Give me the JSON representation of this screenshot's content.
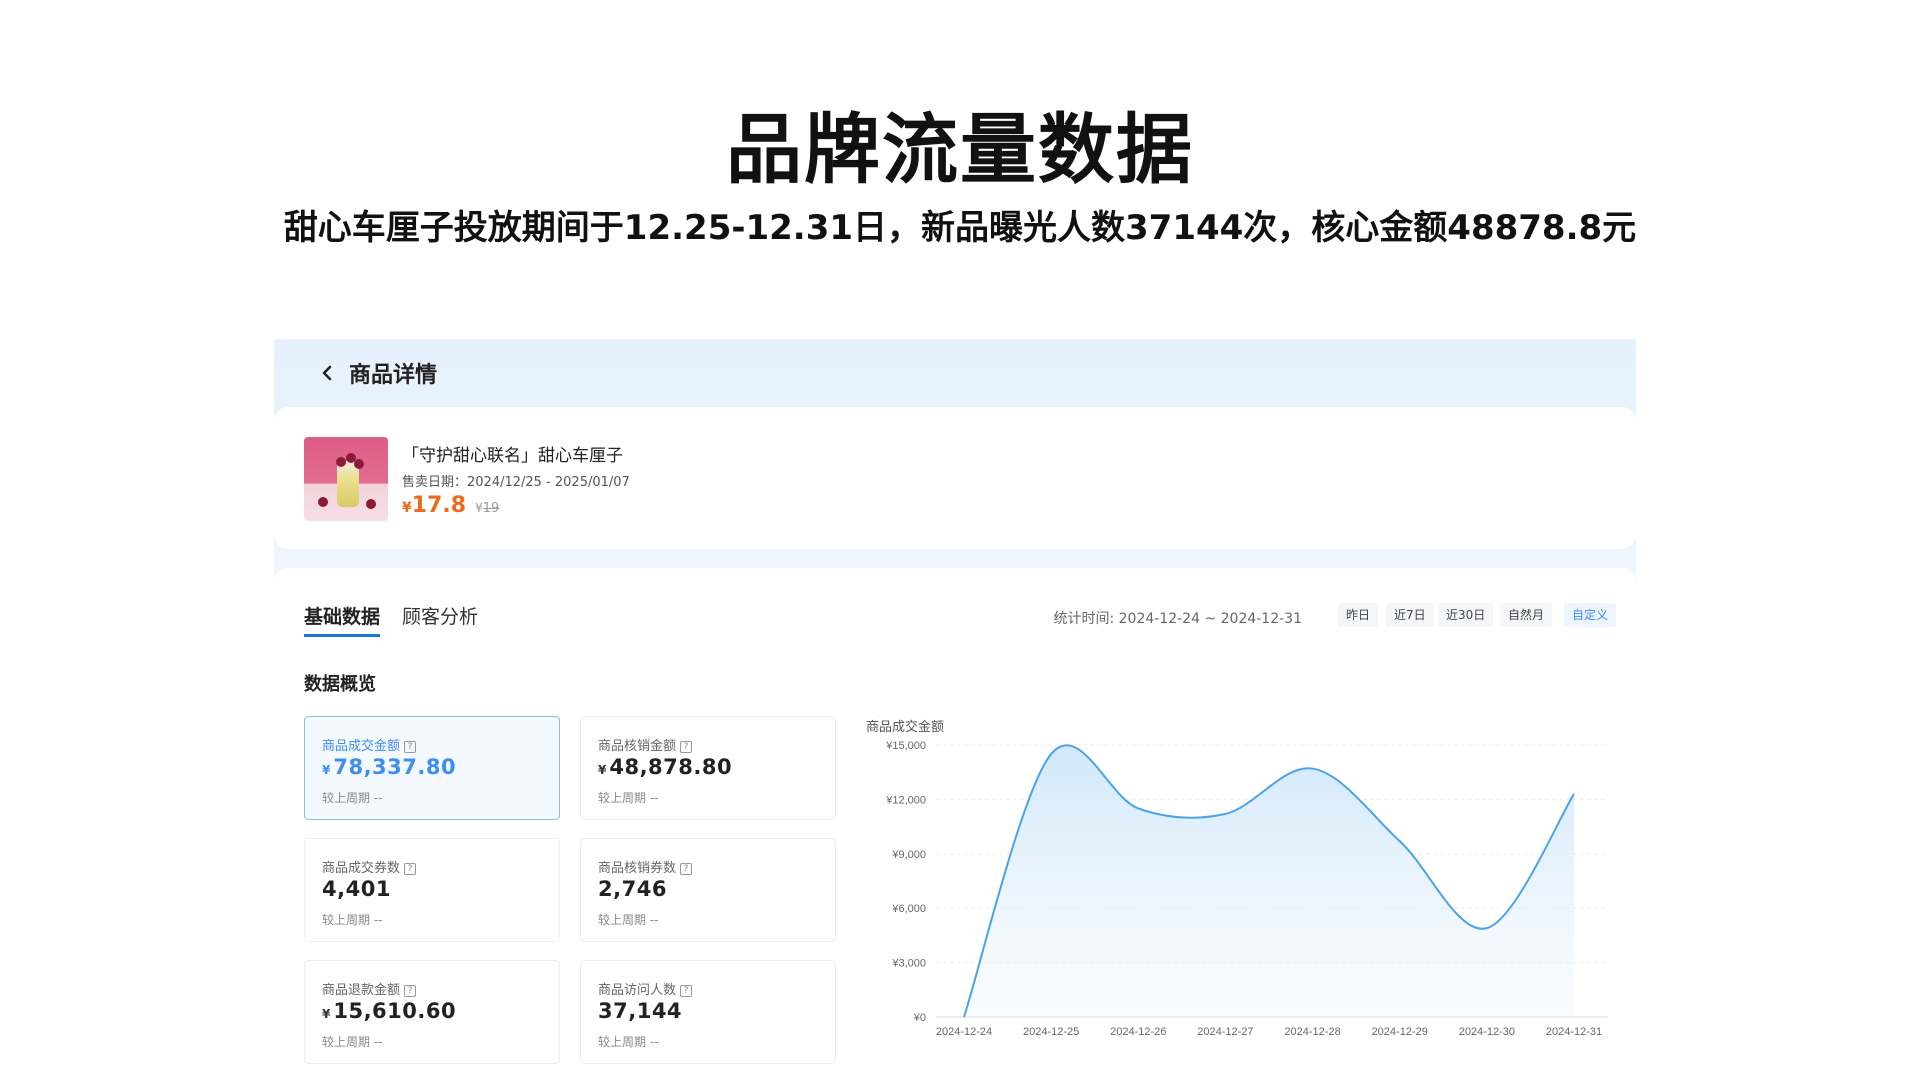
{
  "slide": {
    "title": "品牌流量数据",
    "subtitle": "甜心车厘子投放期间于12.25-12.31日，新品曝光人数37144次，核心金额48878.8元"
  },
  "header": {
    "title": "商品详情"
  },
  "product": {
    "name": "「守护甜心联名」甜心车厘子",
    "sale_date": "售卖日期：2024/12/25 - 2025/01/07",
    "price_symbol": "¥",
    "price": "17.8",
    "original_price_symbol": "¥",
    "original_price": "19"
  },
  "tabs": {
    "basic": "基础数据",
    "customer": "顾客分析"
  },
  "filters": {
    "stat_time": "统计时间: 2024-12-24 ~ 2024-12-31",
    "ranges": [
      "昨日",
      "近7日",
      "近30日",
      "自然月",
      "自定义"
    ],
    "active_range": "自定义"
  },
  "overview": {
    "title": "数据概览",
    "metrics": [
      {
        "label": "商品成交金额",
        "symbol": "¥",
        "value": "78,337.80",
        "compare": "较上周期 --",
        "active": true
      },
      {
        "label": "商品核销金额",
        "symbol": "¥",
        "value": "48,878.80",
        "compare": "较上周期 --",
        "active": false
      },
      {
        "label": "商品成交券数",
        "symbol": "",
        "value": "4,401",
        "compare": "较上周期 --",
        "active": false
      },
      {
        "label": "商品核销券数",
        "symbol": "",
        "value": "2,746",
        "compare": "较上周期 --",
        "active": false
      },
      {
        "label": "商品退款金额",
        "symbol": "¥",
        "value": "15,610.60",
        "compare": "较上周期 --",
        "active": false
      },
      {
        "label": "商品访问人数",
        "symbol": "",
        "value": "37,144",
        "compare": "较上周期 --",
        "active": false
      }
    ],
    "help_glyph": "?"
  },
  "colors": {
    "accent": "#3d8ef0",
    "price": "#ea6a1e",
    "line": "#4aa3e6"
  },
  "chart_data": {
    "type": "area",
    "title": "商品成交金额",
    "x": [
      "2024-12-24",
      "2024-12-25",
      "2024-12-26",
      "2024-12-27",
      "2024-12-28",
      "2024-12-29",
      "2024-12-30",
      "2024-12-31"
    ],
    "values": [
      0,
      14500,
      11500,
      11200,
      13700,
      9700,
      4900,
      12300
    ],
    "ylim": [
      0,
      15000
    ],
    "yticks": [
      0,
      3000,
      6000,
      9000,
      12000,
      15000
    ],
    "ytick_labels": [
      "¥0",
      "¥3,000",
      "¥6,000",
      "¥9,000",
      "¥12,000",
      "¥15,000"
    ],
    "grid": true,
    "curve": "smooth"
  }
}
